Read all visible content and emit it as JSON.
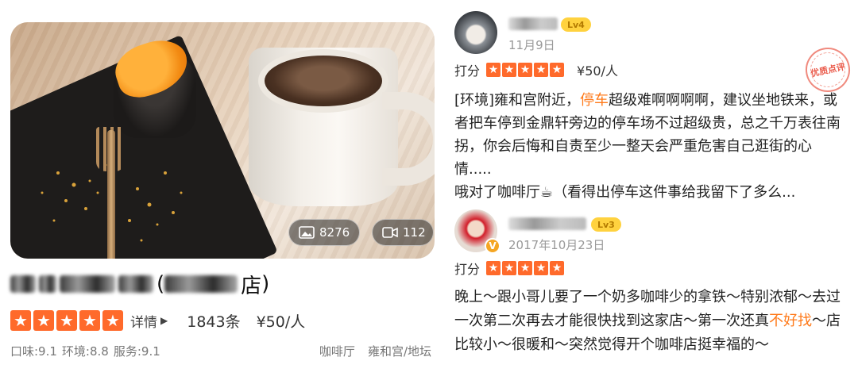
{
  "shop": {
    "photo_count": "8276",
    "video_count": "112",
    "name_suffix": "店",
    "detail_label": "详情",
    "review_count": "1843条",
    "avg_price": "¥50/人",
    "taste": "口味:9.1",
    "environment": "环境:8.8",
    "service": "服务:9.1",
    "category": "咖啡厅",
    "location": "雍和宫/地坛"
  },
  "reviews": [
    {
      "level": "Lv4",
      "date": "11月9日",
      "score_label": "打分",
      "price": "¥50/人",
      "stamp": "优质点评",
      "text_a": "[环境]雍和宫附近，",
      "text_hl": "停车",
      "text_b": "超级难啊啊啊啊，建议坐地铁来，或者把车停到金鼎轩旁边的停车场不过超级贵，总之千万表往南拐，你会后悔和自责至少一整天会严重危害自己逛街的心情.....",
      "text_line2": "哦对了咖啡厅☕（看得出停车这件事给我留下了多么..."
    },
    {
      "level": "Lv3",
      "date": "2017年10月23日",
      "score_label": "打分",
      "text_a": "晚上～跟小哥儿要了一个奶多咖啡少的拿铁～特别浓郁～去过一次第二次再去才能很快找到这家店～第一次还真",
      "text_hl": "不好找",
      "text_b": "～店比较小～很暖和～突然觉得开个咖啡店挺幸福的～"
    }
  ],
  "colors": {
    "star": "#ff6a2b",
    "highlight": "#ff7a1a",
    "level_badge": "#ffd23f",
    "stamp": "#ea5a4a"
  },
  "icons": {
    "photo": "image-icon",
    "video": "video-icon",
    "star": "star-icon",
    "detail_arrow": "triangle-right-icon"
  }
}
